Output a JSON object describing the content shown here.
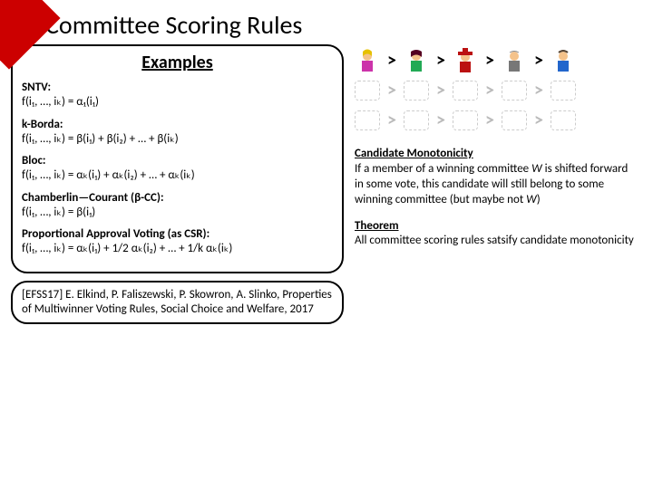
{
  "title": "Committee Scoring Rules",
  "examples": {
    "heading": "Examples",
    "sntv_label": "SNTV:",
    "sntv_formula": "f(i₁, …, iₖ) = α₁(i₁)",
    "kborda_label": "k-Borda:",
    "kborda_formula": "f(i₁, …, iₖ) = β(i₁) + β(i₂) + … + β(iₖ)",
    "bloc_label": "Bloc:",
    "bloc_formula": "f(i₁, …, iₖ) = αₖ(i₁) + αₖ(i₂) + … + αₖ(iₖ)",
    "cc_label": "Chamberlin—Courant (β-CC):",
    "cc_formula": "f(i₁, …, iₖ) = β(i₁)",
    "pav_label": "Proportional Approval Voting (as CSR):",
    "pav_formula": "f(i₁, …, iₖ) = αₖ(i₁) + 1/2 αₖ(i₂) + … + 1/k αₖ(iₖ)"
  },
  "reference": "[EFSS17] E. Elkind, P. Faliszewski, P. Skowron, A. Slinko, Properties of Multiwinner Voting Rules, Social Choice and Welfare, 2017",
  "monotonicity": {
    "heading": "Candidate Monotonicity",
    "body_a": "If a member of a winning committee ",
    "body_W1": "W",
    "body_b": " is shifted forward in some vote, this candidate will still belong to some winning committee (but maybe not ",
    "body_W2": "W",
    "body_c": ")"
  },
  "theorem": {
    "heading": "Theorem",
    "body": "All committee scoring rules satsify candidate monotonicity"
  },
  "gt": ">"
}
